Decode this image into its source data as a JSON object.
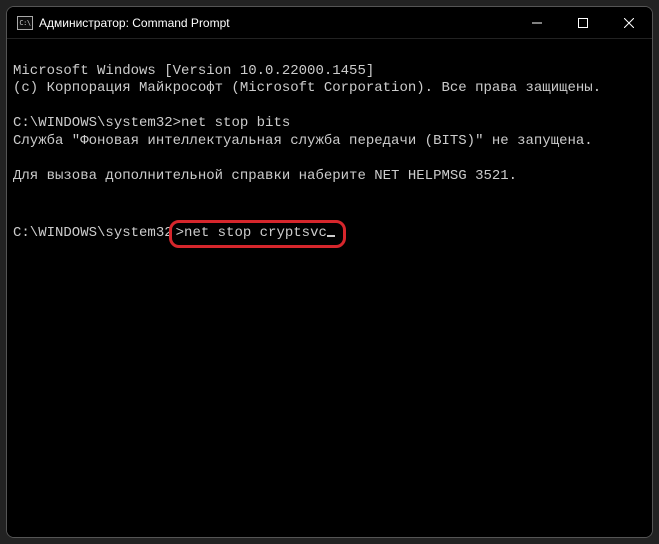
{
  "window": {
    "icon_label": "C:\\",
    "title": "Администратор: Command Prompt"
  },
  "terminal": {
    "line1": "Microsoft Windows [Version 10.0.22000.1455]",
    "line2": "(c) Корпорация Майкрософт (Microsoft Corporation). Все права защищены.",
    "prompt1": "C:\\WINDOWS\\system32>",
    "cmd1": "net stop bits",
    "line3": "Служба \"Фоновая интеллектуальная служба передачи (BITS)\" не запущена.",
    "line4": "Для вызова дополнительной справки наберите NET HELPMSG 3521.",
    "prompt2": "C:\\WINDOWS\\system32",
    "cmd2": ">net stop cryptsvc"
  },
  "highlight": {
    "color": "#d6262c"
  }
}
